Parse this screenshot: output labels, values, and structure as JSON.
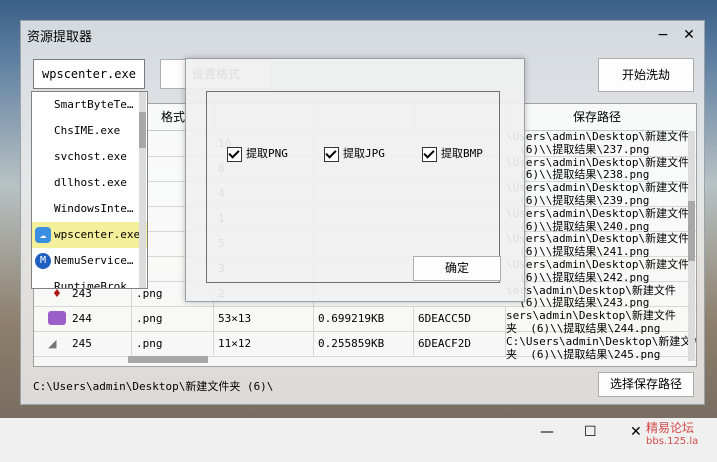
{
  "window": {
    "title": "资源提取器",
    "minimize": "−",
    "close": "✕"
  },
  "toolbar": {
    "process_combo": "wpscenter.exe",
    "format_button": "设置格式",
    "start_button": "开始洗劫",
    "save_path_button": "选择保存路径"
  },
  "dropdown": {
    "items": [
      {
        "label": "SmartByteTe…",
        "icon": ""
      },
      {
        "label": "ChsIME.exe",
        "icon": ""
      },
      {
        "label": "svchost.exe",
        "icon": ""
      },
      {
        "label": "dllhost.exe",
        "icon": ""
      },
      {
        "label": "WindowsInte…",
        "icon": ""
      },
      {
        "label": "wpscenter.exe",
        "icon": "cloud-icon",
        "selected": true
      },
      {
        "label": "NemuService…",
        "icon": "nemu-icon"
      },
      {
        "label": "RuntimeBrok…",
        "icon": ""
      }
    ]
  },
  "table": {
    "headers": [
      "格式",
      "",
      "",
      "",
      "保存路径"
    ],
    "rows": [
      {
        "num": "",
        "ext": "",
        "size": "16",
        "bytes": "",
        "addr": ""
      },
      {
        "num": "",
        "ext": "",
        "size": "8",
        "bytes": "",
        "addr": ""
      },
      {
        "num": "",
        "ext": "",
        "size": "4",
        "bytes": "",
        "addr": ""
      },
      {
        "num": "",
        "ext": "",
        "size": "1",
        "bytes": "",
        "addr": ""
      },
      {
        "num": "",
        "ext": "",
        "size": "5",
        "bytes": "",
        "addr": ""
      },
      {
        "num": "",
        "ext": "",
        "size": "3",
        "bytes": "",
        "addr": ""
      },
      {
        "num": "243",
        "ext": ".png",
        "size": "2",
        "bytes": "",
        "addr": ""
      },
      {
        "num": "244",
        "ext": ".png",
        "size": "53×13",
        "bytes": "0.699219KB",
        "addr": "6DEACC5D"
      },
      {
        "num": "245",
        "ext": ".png",
        "size": "11×12",
        "bytes": "0.255859KB",
        "addr": "6DEACF2D"
      }
    ],
    "paths": "\\Users\\admin\\Desktop\\新建文件\n  (6)\\\\提取结果\\237.png\n\\Users\\admin\\Desktop\\新建文件\n  (6)\\\\提取结果\\238.png\n\\Users\\admin\\Desktop\\新建文件\n  (6)\\\\提取结果\\239.png\n\\Users\\admin\\Desktop\\新建文件\n  (6)\\\\提取结果\\240.png\n\\Users\\admin\\Desktop\\新建文件\n  (6)\\\\提取结果\\241.png\n\\Users\\admin\\Desktop\\新建文件\n  (6)\\\\提取结果\\242.png\nsers\\admin\\Desktop\\新建文件\n  (6)\\\\提取结果\\243.png\nsers\\admin\\Desktop\\新建文件\n夹  (6)\\\\提取结果\\244.png\nC:\\Users\\admin\\Desktop\\新建文件\n夹  (6)\\\\提取结果\\245.png"
  },
  "status": {
    "current_path": "C:\\Users\\admin\\Desktop\\新建文件夹 (6)\\"
  },
  "modal": {
    "options": [
      {
        "label": "提取PNG",
        "checked": true
      },
      {
        "label": "提取JPG",
        "checked": true
      },
      {
        "label": "提取BMP",
        "checked": true
      }
    ],
    "ok_button": "确定"
  },
  "taskbar": {
    "minimize": "—",
    "maximize": "☐",
    "close": "✕"
  },
  "watermark": {
    "line1": "精易论坛",
    "line2": "bbs.125.la"
  },
  "colors": {
    "selected_item": "#f4ef9a",
    "watermark": "#d54a4a"
  }
}
